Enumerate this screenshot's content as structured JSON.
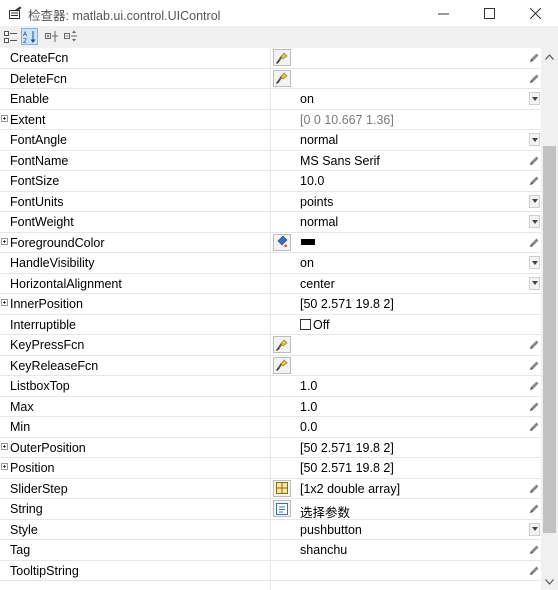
{
  "window": {
    "title": "检查器: matlab.ui.control.UIControl",
    "minimize_glyph": "—",
    "maximize_glyph": "☐",
    "close_glyph": "✕"
  },
  "toolbar": {
    "buttons": [
      {
        "icon": "categorize-icon",
        "active": false
      },
      {
        "icon": "sort-alphabetical-icon",
        "active": true
      },
      {
        "icon": "expand-all-icon",
        "active": false
      },
      {
        "icon": "collapse-all-icon",
        "active": false
      }
    ]
  },
  "properties": [
    {
      "name": "CreateFcn",
      "editor": "callback",
      "value": "",
      "control": "pencil"
    },
    {
      "name": "DeleteFcn",
      "editor": "callback",
      "value": "",
      "control": "pencil"
    },
    {
      "name": "Enable",
      "value": "on",
      "control": "dropdown"
    },
    {
      "name": "Extent",
      "expandable": true,
      "value": "[0 0 10.667 1.36]",
      "value_style": "gray"
    },
    {
      "name": "FontAngle",
      "value": "normal",
      "control": "dropdown"
    },
    {
      "name": "FontName",
      "value": "MS Sans Serif",
      "control": "pencil"
    },
    {
      "name": "FontSize",
      "value": "10.0",
      "control": "pencil"
    },
    {
      "name": "FontUnits",
      "value": "points",
      "control": "dropdown"
    },
    {
      "name": "FontWeight",
      "value": "normal",
      "control": "dropdown"
    },
    {
      "name": "ForegroundColor",
      "expandable": true,
      "editor": "color",
      "value": "",
      "swatch": "#000000",
      "control": "pencil"
    },
    {
      "name": "HandleVisibility",
      "value": "on",
      "control": "dropdown"
    },
    {
      "name": "HorizontalAlignment",
      "value": "center",
      "control": "dropdown"
    },
    {
      "name": "InnerPosition",
      "expandable": true,
      "value": "[50 2.571 19.8 2]"
    },
    {
      "name": "Interruptible",
      "value": "Off",
      "checkbox": true
    },
    {
      "name": "KeyPressFcn",
      "editor": "callback",
      "value": "",
      "control": "pencil"
    },
    {
      "name": "KeyReleaseFcn",
      "editor": "callback",
      "value": "",
      "control": "pencil"
    },
    {
      "name": "ListboxTop",
      "value": "1.0",
      "control": "pencil"
    },
    {
      "name": "Max",
      "value": "1.0",
      "control": "pencil"
    },
    {
      "name": "Min",
      "value": "0.0",
      "control": "pencil"
    },
    {
      "name": "OuterPosition",
      "expandable": true,
      "value": "[50 2.571 19.8 2]"
    },
    {
      "name": "Position",
      "expandable": true,
      "value": "[50 2.571 19.8 2]"
    },
    {
      "name": "SliderStep",
      "editor": "array",
      "value": "[1x2  double array]",
      "control": "pencil"
    },
    {
      "name": "String",
      "editor": "text",
      "value": "选择参数",
      "control": "pencil"
    },
    {
      "name": "Style",
      "value": "pushbutton",
      "control": "dropdown"
    },
    {
      "name": "Tag",
      "value": "shanchu",
      "control": "pencil"
    },
    {
      "name": "TooltipString",
      "value": "",
      "control": "pencil"
    },
    {
      "name": "",
      "value": ""
    }
  ],
  "scrollbar": {
    "up_glyph": "⌃",
    "down_glyph": "⌄"
  },
  "colors": {
    "grid_line": "#e6e6e6",
    "toolbar_bg": "#f0f0f0",
    "readonly_text": "#7a7a7a"
  }
}
